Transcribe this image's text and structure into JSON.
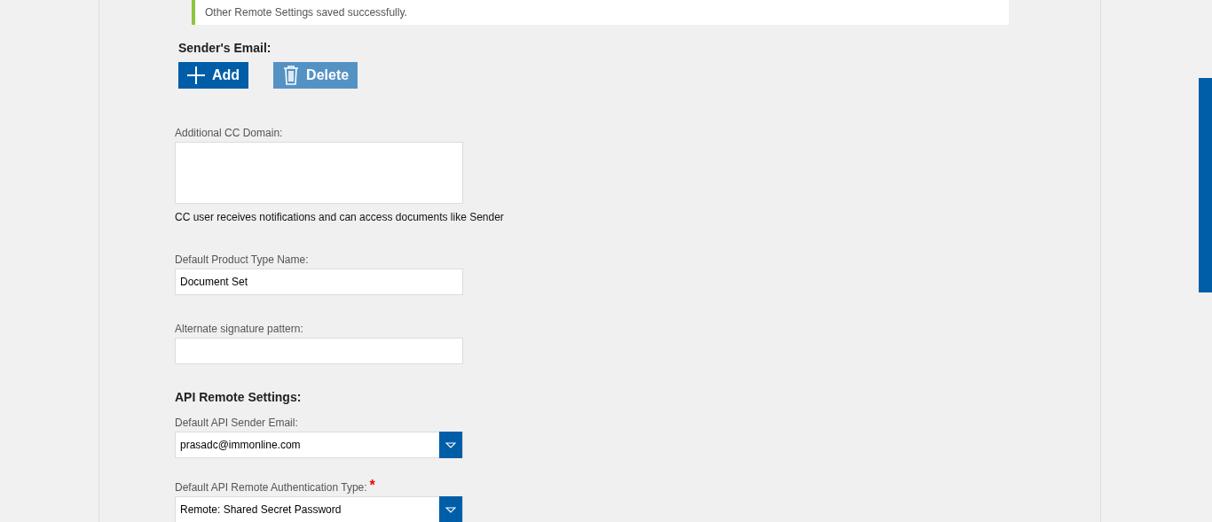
{
  "alert": {
    "message": "Other Remote Settings saved successfully."
  },
  "senders_email": {
    "title": "Sender's Email:",
    "buttons": [
      {
        "label": "Add",
        "kind": "add",
        "disabled": false
      },
      {
        "label": "Delete",
        "kind": "delete",
        "disabled": true
      }
    ]
  },
  "fields": [
    {
      "kind": "textarea",
      "label": "Additional CC Domain:",
      "help": "CC user receives notifications and can access documents like Sender"
    },
    {
      "kind": "text",
      "label": "Default Product Type Name:",
      "value": "Document Set"
    },
    {
      "kind": "text",
      "label": "Alternate signature pattern:"
    },
    {
      "kind": "heading",
      "label": "API Remote Settings:"
    },
    {
      "kind": "select",
      "label": "Default API Sender Email:",
      "value": "prasadc@immonline.com"
    },
    {
      "kind": "select",
      "label": "Default API Remote Authentication Type:",
      "value": "Remote: Shared Secret Password",
      "required_mark": "*"
    }
  ]
}
